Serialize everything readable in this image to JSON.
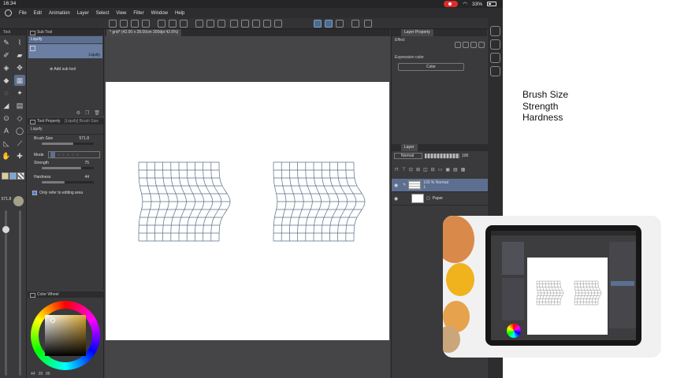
{
  "status_bar": {
    "time": "16:34",
    "battery": "33%"
  },
  "menu": [
    "File",
    "Edit",
    "Animation",
    "Layer",
    "Select",
    "View",
    "Filter",
    "Window",
    "Help"
  ],
  "document_tab": "* grid* (42.00 x 28.00cm 300dpi 42.6%)",
  "tool_panel": {
    "header": "Tool",
    "size_value": "571.8"
  },
  "sub_tool": {
    "header": "Sub Tool",
    "group_tab": "Liquify",
    "item_label": "Liquify",
    "add_button": "Add sub tool"
  },
  "tool_property": {
    "header": "Tool Property",
    "header_right": "[Liquify] Brush Size",
    "tool_name": "Liquify",
    "properties": [
      {
        "name": "Brush Size",
        "value": "571.8",
        "fraction": 0.6
      },
      {
        "name": "Strength",
        "value": "75",
        "fraction": 0.75
      },
      {
        "name": "Hardness",
        "value": "44",
        "fraction": 0.44
      }
    ],
    "mode_label": "Mode",
    "checkbox_label": "Only refer to editing area"
  },
  "color_wheel": {
    "header": "Color Wheel",
    "values": [
      "44",
      "28",
      "86"
    ]
  },
  "layer_property": {
    "header": "Layer Property",
    "effect_label": "Effect",
    "expression_label": "Expression color",
    "expression_value": "Color"
  },
  "layer_panel": {
    "header": "Layer",
    "blend_mode": "Normal",
    "opacity": "100",
    "layers": [
      {
        "name": "100 % Normal",
        "sub": "1",
        "selected": true
      },
      {
        "name": "Paper",
        "sub": "",
        "selected": false
      }
    ]
  },
  "notes": [
    "Brush Size",
    "Strength",
    "Hardness"
  ],
  "colors": {
    "accent": "#5c6f90",
    "panel": "#3a3a3c",
    "grid_line": "#5a6b84"
  }
}
